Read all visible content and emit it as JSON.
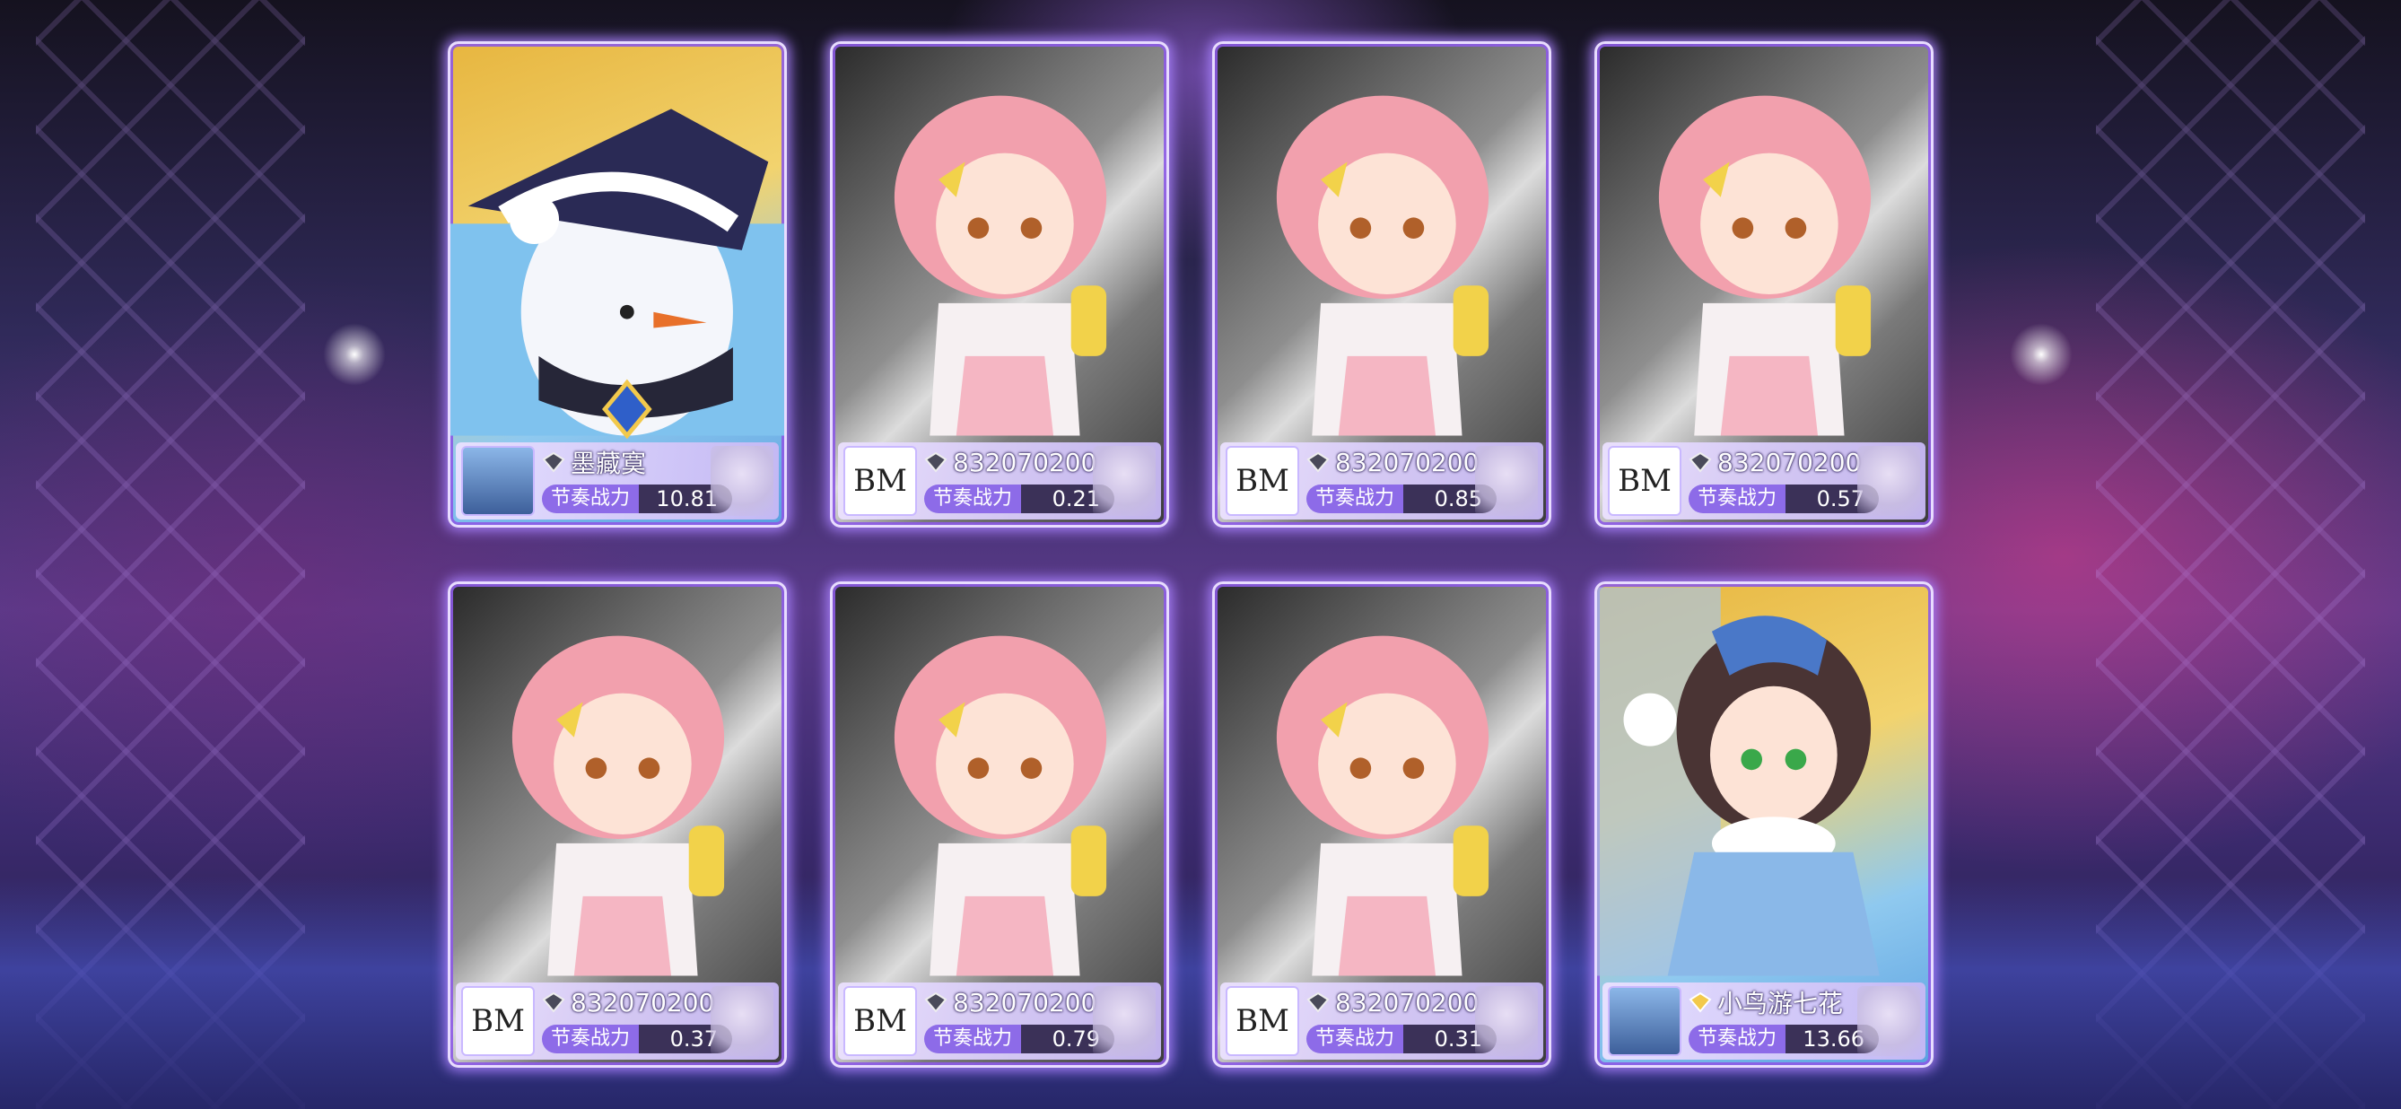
{
  "cards": [
    {
      "theme": "gold",
      "character": "wizard-snowman",
      "avatar": "portrait",
      "avatar_text": "",
      "name": "墨藏寞",
      "power_label": "节奏战力",
      "power": "10.81"
    },
    {
      "theme": "silver",
      "character": "pink-hair-girl",
      "avatar": "logo",
      "avatar_text": "BM",
      "name": "832070200",
      "power_label": "节奏战力",
      "power": "0.21"
    },
    {
      "theme": "silver",
      "character": "pink-hair-girl",
      "avatar": "logo",
      "avatar_text": "BM",
      "name": "832070200",
      "power_label": "节奏战力",
      "power": "0.85"
    },
    {
      "theme": "silver",
      "character": "pink-hair-girl",
      "avatar": "logo",
      "avatar_text": "BM",
      "name": "832070200",
      "power_label": "节奏战力",
      "power": "0.57"
    },
    {
      "theme": "silver",
      "character": "pink-hair-girl",
      "avatar": "logo",
      "avatar_text": "BM",
      "name": "832070200",
      "power_label": "节奏战力",
      "power": "0.37"
    },
    {
      "theme": "silver",
      "character": "pink-hair-girl",
      "avatar": "logo",
      "avatar_text": "BM",
      "name": "832070200",
      "power_label": "节奏战力",
      "power": "0.79"
    },
    {
      "theme": "silver",
      "character": "pink-hair-girl",
      "avatar": "logo",
      "avatar_text": "BM",
      "name": "832070200",
      "power_label": "节奏战力",
      "power": "0.31"
    },
    {
      "theme": "gold",
      "character": "winter-girl",
      "avatar": "portrait",
      "avatar_text": "",
      "name": "小鸟游七花",
      "power_label": "节奏战力",
      "power": "13.66"
    }
  ],
  "colors": {
    "card_border": "#e8dcff",
    "glow": "#aa82ff",
    "power_label_bg": "#8d6be8",
    "power_value_bg": "#3b3158"
  }
}
